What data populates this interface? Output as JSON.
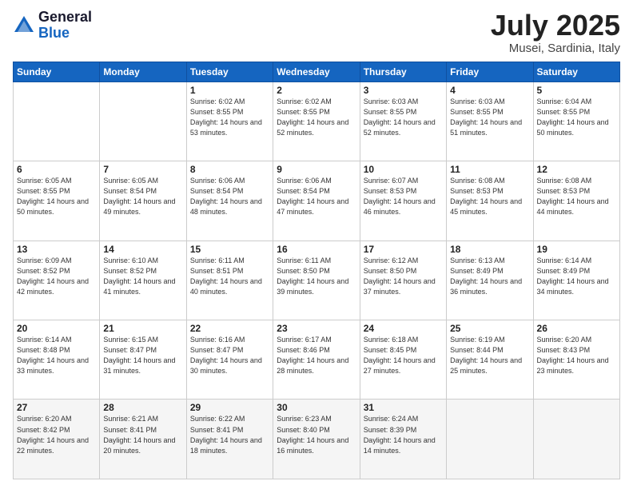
{
  "header": {
    "logo_general": "General",
    "logo_blue": "Blue",
    "month_title": "July 2025",
    "location": "Musei, Sardinia, Italy"
  },
  "weekdays": [
    "Sunday",
    "Monday",
    "Tuesday",
    "Wednesday",
    "Thursday",
    "Friday",
    "Saturday"
  ],
  "weeks": [
    [
      {
        "day": "",
        "sunrise": "",
        "sunset": "",
        "daylight": ""
      },
      {
        "day": "",
        "sunrise": "",
        "sunset": "",
        "daylight": ""
      },
      {
        "day": "1",
        "sunrise": "Sunrise: 6:02 AM",
        "sunset": "Sunset: 8:55 PM",
        "daylight": "Daylight: 14 hours and 53 minutes."
      },
      {
        "day": "2",
        "sunrise": "Sunrise: 6:02 AM",
        "sunset": "Sunset: 8:55 PM",
        "daylight": "Daylight: 14 hours and 52 minutes."
      },
      {
        "day": "3",
        "sunrise": "Sunrise: 6:03 AM",
        "sunset": "Sunset: 8:55 PM",
        "daylight": "Daylight: 14 hours and 52 minutes."
      },
      {
        "day": "4",
        "sunrise": "Sunrise: 6:03 AM",
        "sunset": "Sunset: 8:55 PM",
        "daylight": "Daylight: 14 hours and 51 minutes."
      },
      {
        "day": "5",
        "sunrise": "Sunrise: 6:04 AM",
        "sunset": "Sunset: 8:55 PM",
        "daylight": "Daylight: 14 hours and 50 minutes."
      }
    ],
    [
      {
        "day": "6",
        "sunrise": "Sunrise: 6:05 AM",
        "sunset": "Sunset: 8:55 PM",
        "daylight": "Daylight: 14 hours and 50 minutes."
      },
      {
        "day": "7",
        "sunrise": "Sunrise: 6:05 AM",
        "sunset": "Sunset: 8:54 PM",
        "daylight": "Daylight: 14 hours and 49 minutes."
      },
      {
        "day": "8",
        "sunrise": "Sunrise: 6:06 AM",
        "sunset": "Sunset: 8:54 PM",
        "daylight": "Daylight: 14 hours and 48 minutes."
      },
      {
        "day": "9",
        "sunrise": "Sunrise: 6:06 AM",
        "sunset": "Sunset: 8:54 PM",
        "daylight": "Daylight: 14 hours and 47 minutes."
      },
      {
        "day": "10",
        "sunrise": "Sunrise: 6:07 AM",
        "sunset": "Sunset: 8:53 PM",
        "daylight": "Daylight: 14 hours and 46 minutes."
      },
      {
        "day": "11",
        "sunrise": "Sunrise: 6:08 AM",
        "sunset": "Sunset: 8:53 PM",
        "daylight": "Daylight: 14 hours and 45 minutes."
      },
      {
        "day": "12",
        "sunrise": "Sunrise: 6:08 AM",
        "sunset": "Sunset: 8:53 PM",
        "daylight": "Daylight: 14 hours and 44 minutes."
      }
    ],
    [
      {
        "day": "13",
        "sunrise": "Sunrise: 6:09 AM",
        "sunset": "Sunset: 8:52 PM",
        "daylight": "Daylight: 14 hours and 42 minutes."
      },
      {
        "day": "14",
        "sunrise": "Sunrise: 6:10 AM",
        "sunset": "Sunset: 8:52 PM",
        "daylight": "Daylight: 14 hours and 41 minutes."
      },
      {
        "day": "15",
        "sunrise": "Sunrise: 6:11 AM",
        "sunset": "Sunset: 8:51 PM",
        "daylight": "Daylight: 14 hours and 40 minutes."
      },
      {
        "day": "16",
        "sunrise": "Sunrise: 6:11 AM",
        "sunset": "Sunset: 8:50 PM",
        "daylight": "Daylight: 14 hours and 39 minutes."
      },
      {
        "day": "17",
        "sunrise": "Sunrise: 6:12 AM",
        "sunset": "Sunset: 8:50 PM",
        "daylight": "Daylight: 14 hours and 37 minutes."
      },
      {
        "day": "18",
        "sunrise": "Sunrise: 6:13 AM",
        "sunset": "Sunset: 8:49 PM",
        "daylight": "Daylight: 14 hours and 36 minutes."
      },
      {
        "day": "19",
        "sunrise": "Sunrise: 6:14 AM",
        "sunset": "Sunset: 8:49 PM",
        "daylight": "Daylight: 14 hours and 34 minutes."
      }
    ],
    [
      {
        "day": "20",
        "sunrise": "Sunrise: 6:14 AM",
        "sunset": "Sunset: 8:48 PM",
        "daylight": "Daylight: 14 hours and 33 minutes."
      },
      {
        "day": "21",
        "sunrise": "Sunrise: 6:15 AM",
        "sunset": "Sunset: 8:47 PM",
        "daylight": "Daylight: 14 hours and 31 minutes."
      },
      {
        "day": "22",
        "sunrise": "Sunrise: 6:16 AM",
        "sunset": "Sunset: 8:47 PM",
        "daylight": "Daylight: 14 hours and 30 minutes."
      },
      {
        "day": "23",
        "sunrise": "Sunrise: 6:17 AM",
        "sunset": "Sunset: 8:46 PM",
        "daylight": "Daylight: 14 hours and 28 minutes."
      },
      {
        "day": "24",
        "sunrise": "Sunrise: 6:18 AM",
        "sunset": "Sunset: 8:45 PM",
        "daylight": "Daylight: 14 hours and 27 minutes."
      },
      {
        "day": "25",
        "sunrise": "Sunrise: 6:19 AM",
        "sunset": "Sunset: 8:44 PM",
        "daylight": "Daylight: 14 hours and 25 minutes."
      },
      {
        "day": "26",
        "sunrise": "Sunrise: 6:20 AM",
        "sunset": "Sunset: 8:43 PM",
        "daylight": "Daylight: 14 hours and 23 minutes."
      }
    ],
    [
      {
        "day": "27",
        "sunrise": "Sunrise: 6:20 AM",
        "sunset": "Sunset: 8:42 PM",
        "daylight": "Daylight: 14 hours and 22 minutes."
      },
      {
        "day": "28",
        "sunrise": "Sunrise: 6:21 AM",
        "sunset": "Sunset: 8:41 PM",
        "daylight": "Daylight: 14 hours and 20 minutes."
      },
      {
        "day": "29",
        "sunrise": "Sunrise: 6:22 AM",
        "sunset": "Sunset: 8:41 PM",
        "daylight": "Daylight: 14 hours and 18 minutes."
      },
      {
        "day": "30",
        "sunrise": "Sunrise: 6:23 AM",
        "sunset": "Sunset: 8:40 PM",
        "daylight": "Daylight: 14 hours and 16 minutes."
      },
      {
        "day": "31",
        "sunrise": "Sunrise: 6:24 AM",
        "sunset": "Sunset: 8:39 PM",
        "daylight": "Daylight: 14 hours and 14 minutes."
      },
      {
        "day": "",
        "sunrise": "",
        "sunset": "",
        "daylight": ""
      },
      {
        "day": "",
        "sunrise": "",
        "sunset": "",
        "daylight": ""
      }
    ]
  ]
}
